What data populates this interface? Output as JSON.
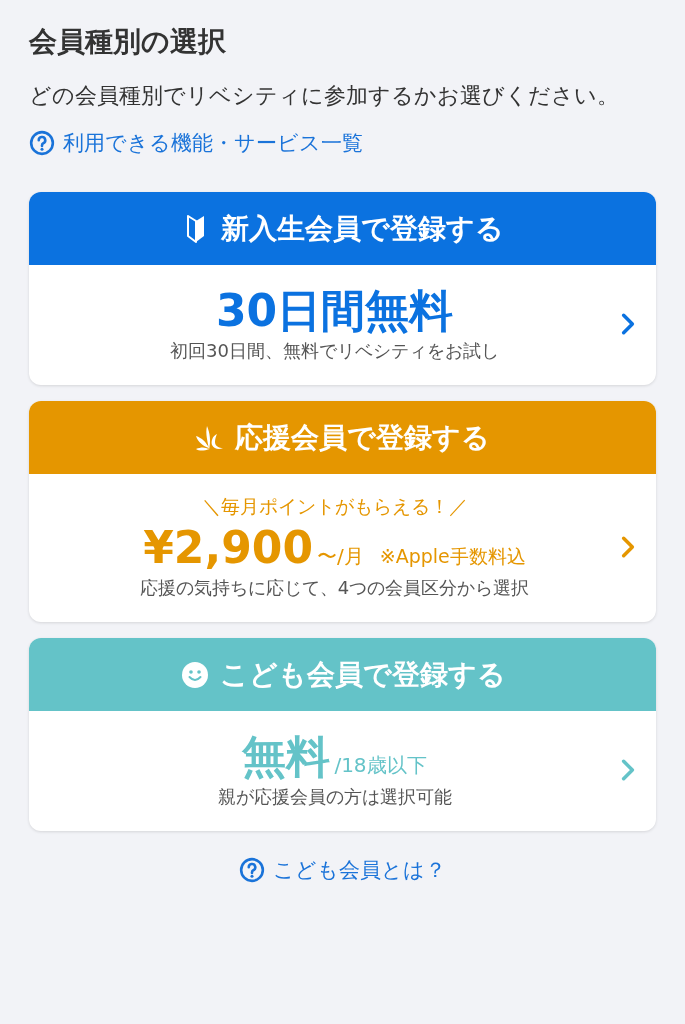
{
  "title": "会員種別の選択",
  "description": "どの会員種別でリベシティに参加するかお選びください。",
  "features_link": "利用できる機能・サービス一覧",
  "cards": [
    {
      "kind": "beginner",
      "color": "#0b72e0",
      "title": "新入生会員で登録する",
      "price": "30日間無料",
      "description": "初回30日間、無料でリベシティをお試し"
    },
    {
      "kind": "support",
      "color": "#e59600",
      "title": "応援会員で登録する",
      "tagline": "＼毎月ポイントがもらえる！／",
      "price": "¥2,900",
      "price_suffix": "〜/月",
      "note": "※Apple手数料込",
      "description": "応援の気持ちに応じて、4つの会員区分から選択"
    },
    {
      "kind": "child",
      "color": "#64c3c8",
      "title": "こども会員で登録する",
      "price": "無料",
      "price_suffix": "/18歳以下",
      "description": "親が応援会員の方は選択可能"
    }
  ],
  "child_link": "こども会員とは？"
}
